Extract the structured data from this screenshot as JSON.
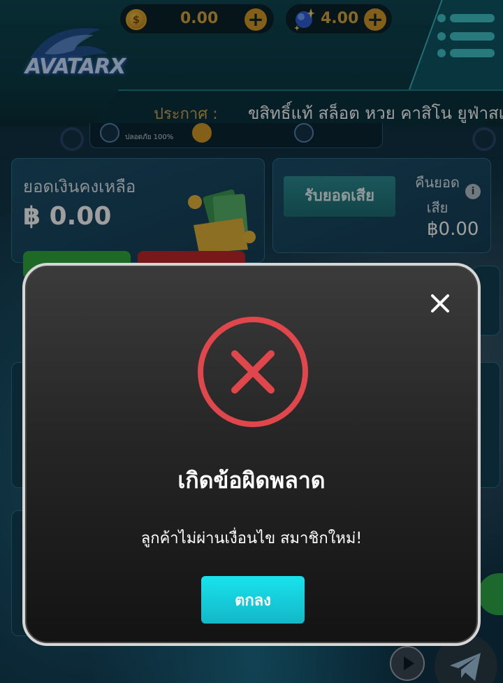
{
  "header": {
    "logo_text": "AVATARX",
    "coin_balance": "0.00",
    "gem_balance": "4.00",
    "coin_symbol": "$",
    "plus_symbol": "+",
    "announcement_label": "ประกาศ :",
    "announcement_text": "ขสิทธิ์แท้ สล็อต หวย คาสิโน ยูฟ่าสเ"
  },
  "trust_strip": {
    "item_1": "ปลอดภัย 100%"
  },
  "balance_card": {
    "label": "ยอดเงินคงเหลือ",
    "value": "฿ 0.00"
  },
  "cashback_card": {
    "claim_button": "รับยอดเสีย",
    "label": "คืนยอดเสีย",
    "info_symbol": "i",
    "value": "฿0.00"
  },
  "modal": {
    "title": "เกิดข้อผิดพลาด",
    "message": "ลูกค้าไม่ผ่านเงื่อนไข สมาชิกใหม่!",
    "ok_button": "ตกลง",
    "close_icon": "close-icon",
    "status_icon": "error-x-circle-icon"
  },
  "colors": {
    "accent_cyan": "#14c9d8",
    "error_red": "#e0474c",
    "gold": "#d8a73d"
  }
}
